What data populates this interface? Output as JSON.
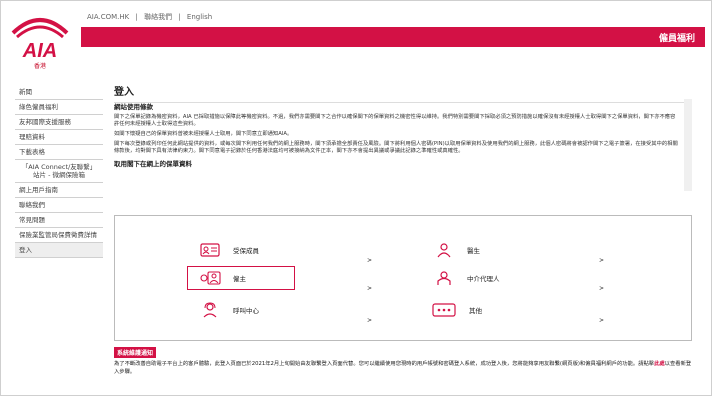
{
  "header": {
    "logo_text": "AIA",
    "logo_sub": "香港",
    "links": [
      "AIA.COM.HK",
      "|",
      "聯絡我們",
      "|",
      "English"
    ],
    "banner_label": "僱員福利"
  },
  "sidebar": {
    "items": [
      {
        "label": "新聞"
      },
      {
        "label": "綠色僱員福利"
      },
      {
        "label": "友邦國際支援服務"
      },
      {
        "label": "理賠資料"
      },
      {
        "label": "下載表格"
      },
      {
        "label": "「AIA Connect/友聯繫」站片 - 微網保險箱"
      },
      {
        "label": "網上用戶指南"
      },
      {
        "label": "聯絡我們"
      },
      {
        "label": "常見問題"
      },
      {
        "label": "保險業監管局保費徵費詳情"
      },
      {
        "label": "登入"
      }
    ]
  },
  "main": {
    "title": "登入",
    "terms_heading": "網站使用條款",
    "terms_p1": "閣下之保單記錄為機密資料，AIA 已採取措施以保障此等機密資料。不過，我們亦需要閣下之合作以確保閣下的保單資料之機密性得以維持。我們特別需要閣下採取必須之預防措施以確保沒有未經授權人士取得閣下之保單資料，閣下亦不應容許任何未經授權人士取得這些資料。",
    "terms_p2": "如閣下懷疑自己的保單資料曾被未經授權人士取用，閣下同意立即通知AIA。",
    "terms_p3": "閣下每次登錄或列印任何此網站提供的資料，或每次閣下利用任何我們的網上服務時，閣下須承擔全部責任及風險。閣下將利用個人密碼(PIN)以取用保單資料及使用我們的網上服務，此個人密碼將會被認作閣下之電子簽署，在接受其中的相關條款後，均對閣下具有法律約束力。閣下同意電子記錄於任何香港法庭均可被接納為文件正本，閣下亦不會提出異議或爭議此記錄之準確性或真確性。",
    "terms_heading2": "取用閣下在網上的保單資料"
  },
  "login_options": [
    {
      "label": "受保成員",
      "icon": "member-card-icon"
    },
    {
      "label": "醫生",
      "icon": "doctor-icon"
    },
    {
      "label": "僱主",
      "icon": "employer-icon"
    },
    {
      "label": "中介代理人",
      "icon": "agent-icon"
    },
    {
      "label": "呼叫中心",
      "icon": "call-centre-icon"
    },
    {
      "label": "其他",
      "icon": "more-icon"
    }
  ],
  "arrow_glyph": ">",
  "notice": {
    "title": "系統維護通知",
    "text_a": "為了不斷改善自助電子平台上的客戶體驗，此登入頁面已於2021年2月上旬開始由友聯繫登入頁面代替。您可以繼續使用您現時的用戶帳號和密碼登入系統，成功登入後，您將能夠享用友聯繫(網頁版)和僱員福利網戶的功能。請點擊",
    "link": "此處",
    "text_b": "以查看新登入步驟。"
  },
  "colors": {
    "brand_red": "#d31145"
  }
}
